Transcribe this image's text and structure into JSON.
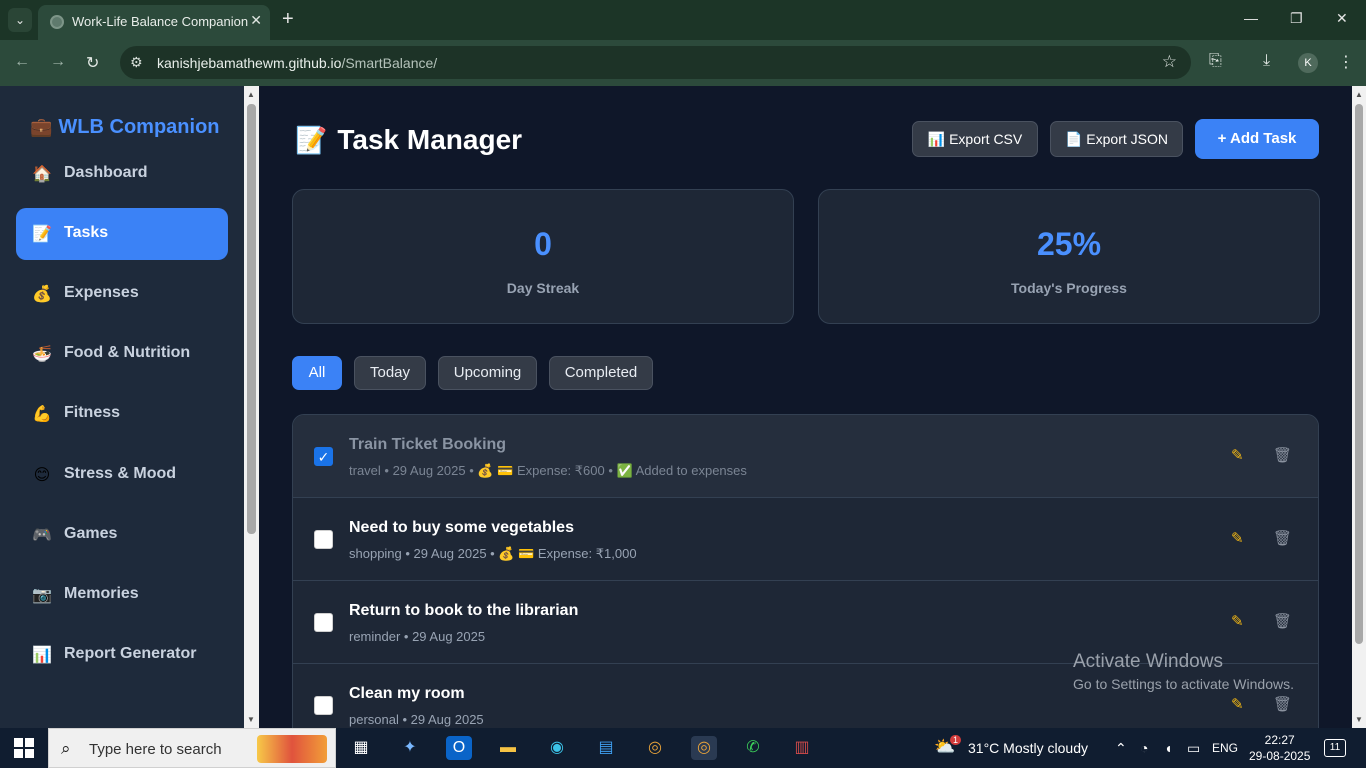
{
  "browser": {
    "tab_title": "Work-Life Balance Companion",
    "url_host": "kanishjebamathewm.github.io",
    "url_path": "/SmartBalance/",
    "profile_initial": "K"
  },
  "sidebar": {
    "brand": "WLB Companion",
    "brand_icon": "briefcase-icon",
    "items": [
      {
        "label": "Dashboard",
        "icon": "house-icon",
        "glyph": "🏠"
      },
      {
        "label": "Tasks",
        "icon": "memo-icon",
        "glyph": "📝",
        "active": true
      },
      {
        "label": "Expenses",
        "icon": "money-bag-icon",
        "glyph": "💰"
      },
      {
        "label": "Food & Nutrition",
        "icon": "bowl-icon",
        "glyph": "🍜"
      },
      {
        "label": "Fitness",
        "icon": "flexed-biceps-icon",
        "glyph": "💪"
      },
      {
        "label": "Stress & Mood",
        "icon": "smiley-icon",
        "glyph": "😊"
      },
      {
        "label": "Games",
        "icon": "gamepad-icon",
        "glyph": "🎮"
      },
      {
        "label": "Memories",
        "icon": "camera-icon",
        "glyph": "📷"
      },
      {
        "label": "Report Generator",
        "icon": "bar-chart-icon",
        "glyph": "📊"
      }
    ]
  },
  "main": {
    "title": "Task Manager",
    "title_icon": "memo-icon",
    "export_csv": "📊 Export CSV",
    "export_json": "📄 Export JSON",
    "add_task": "+ Add Task",
    "stats": [
      {
        "value": "0",
        "label": "Day Streak"
      },
      {
        "value": "25%",
        "label": "Today's Progress"
      }
    ],
    "filters": [
      "All",
      "Today",
      "Upcoming",
      "Completed"
    ],
    "active_filter": "All",
    "tasks": [
      {
        "title": "Train Ticket Booking",
        "meta": "travel • 29 Aug 2025 • 💰 💳 Expense: ₹600 • ✅ Added to expenses",
        "completed": true
      },
      {
        "title": "Need to buy some vegetables",
        "meta": "shopping • 29 Aug 2025 • 💰 💳 Expense: ₹1,000",
        "completed": false
      },
      {
        "title": "Return to book to the librarian",
        "meta": "reminder • 29 Aug 2025",
        "completed": false
      },
      {
        "title": "Clean my room",
        "meta": "personal • 29 Aug 2025",
        "completed": false
      }
    ]
  },
  "watermark": {
    "line1": "Activate Windows",
    "line2": "Go to Settings to activate Windows."
  },
  "taskbar": {
    "search_placeholder": "Type here to search",
    "weather": "31°C  Mostly cloudy",
    "weather_badge": "1",
    "lang": "ENG",
    "time": "22:27",
    "date": "29-08-2025",
    "notifications": "11"
  },
  "colors": {
    "accent": "#3b82f6",
    "brand": "#4a90ff",
    "sidebar_bg": "#1e2a3b",
    "main_bg": "#0f1729"
  }
}
